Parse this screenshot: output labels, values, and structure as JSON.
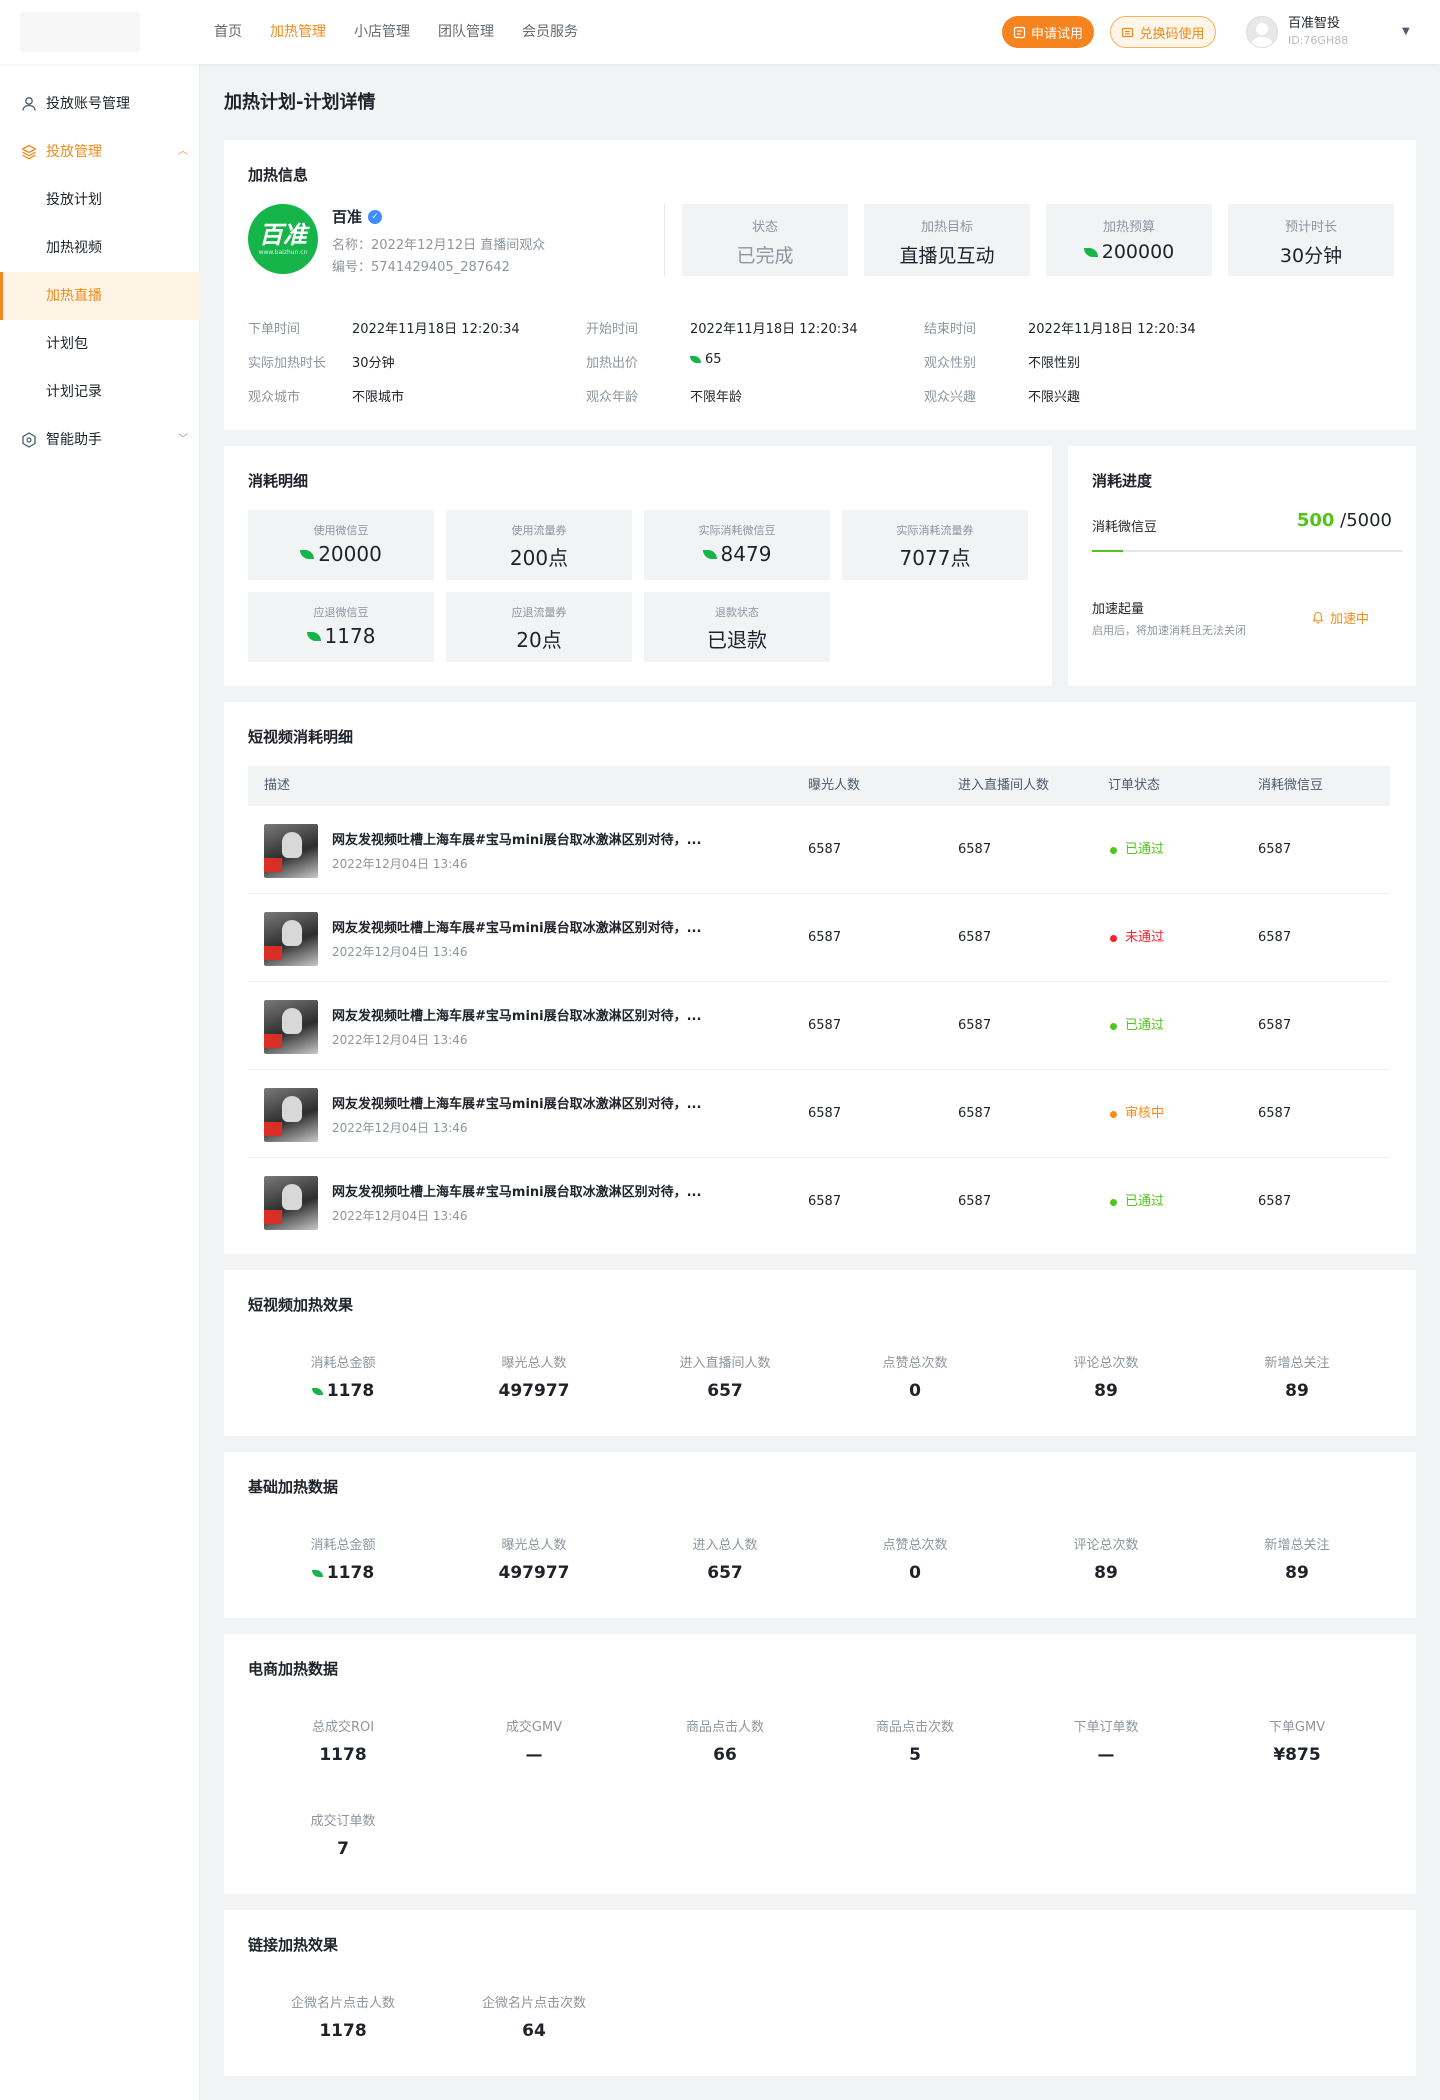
{
  "nav": {
    "items": [
      "首页",
      "加热管理",
      "小店管理",
      "团队管理",
      "会员服务"
    ],
    "active_index": 1,
    "apply_trial": "申请试用",
    "redeem_code": "兑换码使用",
    "user_name": "百准智投",
    "user_id": "ID:76GH88"
  },
  "sidebar": {
    "account_mgmt": "投放账号管理",
    "delivery_mgmt": "投放管理",
    "sub_items": [
      "投放计划",
      "加热视频",
      "加热直播",
      "计划包",
      "计划记录"
    ],
    "active_sub_index": 2,
    "assistant": "智能助手"
  },
  "page_title": "加热计划-计划详情",
  "heat_info": {
    "title": "加热信息",
    "logo_text": "百准",
    "logo_sub": "www.baizhun.cn",
    "account_name": "百准",
    "name_line": "名称：2022年12月12日 直播间观众",
    "id_line": "编号：5741429405_287642",
    "stats": [
      {
        "label": "状态",
        "value": "已完成"
      },
      {
        "label": "加热目标",
        "value": "直播见互动"
      },
      {
        "label": "加热预算",
        "value": "200000"
      },
      {
        "label": "预计时长",
        "value": "30分钟"
      }
    ],
    "fields": [
      {
        "label": "下单时间",
        "value": "2022年11月18日 12:20:34"
      },
      {
        "label": "开始时间",
        "value": "2022年11月18日 12:20:34"
      },
      {
        "label": "结束时间",
        "value": "2022年11月18日 12:20:34"
      },
      {
        "label": "实际加热时长",
        "value": "30分钟"
      },
      {
        "label": "加热出价",
        "value": "65"
      },
      {
        "label": "观众性别",
        "value": "不限性别"
      },
      {
        "label": "观众城市",
        "value": "不限城市"
      },
      {
        "label": "观众年龄",
        "value": "不限年龄"
      },
      {
        "label": "观众兴趣",
        "value": "不限兴趣"
      }
    ]
  },
  "consume_detail": {
    "title": "消耗明细",
    "metrics": [
      {
        "label": "使用微信豆",
        "value": "20000",
        "bean": true
      },
      {
        "label": "使用流量券",
        "value": "200点",
        "bean": false
      },
      {
        "label": "实际消耗微信豆",
        "value": "8479",
        "bean": true
      },
      {
        "label": "实际消耗流量券",
        "value": "7077点",
        "bean": false
      },
      {
        "label": "应退微信豆",
        "value": "1178",
        "bean": true
      },
      {
        "label": "应退流量券",
        "value": "20点",
        "bean": false
      },
      {
        "label": "退款状态",
        "value": "已退款",
        "bean": false
      }
    ]
  },
  "consume_progress": {
    "title": "消耗进度",
    "label": "消耗微信豆",
    "used": "500",
    "total": "/5000",
    "fraction": 0.1,
    "accel_title": "加速起量",
    "accel_desc": "启用后，将加速消耗且无法关闭",
    "accel_status": "加速中"
  },
  "video_table": {
    "title": "短视频消耗明细",
    "headers": [
      "描述",
      "曝光人数",
      "进入直播间人数",
      "订单状态",
      "消耗微信豆"
    ],
    "rows": [
      {
        "title": "网友发视频吐槽上海车展#宝马mini展台取冰激淋区别对待，...",
        "date": "2022年12月04日 13:46",
        "exposure": "6587",
        "enter": "6587",
        "status": "已通过",
        "status_color": "#52c41a",
        "beans": "6587"
      },
      {
        "title": "网友发视频吐槽上海车展#宝马mini展台取冰激淋区别对待，...",
        "date": "2022年12月04日 13:46",
        "exposure": "6587",
        "enter": "6587",
        "status": "未通过",
        "status_color": "#f5222d",
        "beans": "6587"
      },
      {
        "title": "网友发视频吐槽上海车展#宝马mini展台取冰激淋区别对待，...",
        "date": "2022年12月04日 13:46",
        "exposure": "6587",
        "enter": "6587",
        "status": "已通过",
        "status_color": "#52c41a",
        "beans": "6587"
      },
      {
        "title": "网友发视频吐槽上海车展#宝马mini展台取冰激淋区别对待，...",
        "date": "2022年12月04日 13:46",
        "exposure": "6587",
        "enter": "6587",
        "status": "审核中",
        "status_color": "#fa8c16",
        "beans": "6587"
      },
      {
        "title": "网友发视频吐槽上海车展#宝马mini展台取冰激淋区别对待，...",
        "date": "2022年12月04日 13:46",
        "exposure": "6587",
        "enter": "6587",
        "status": "已通过",
        "status_color": "#52c41a",
        "beans": "6587"
      }
    ]
  },
  "video_effect": {
    "title": "短视频加热效果",
    "stats": [
      {
        "label": "消耗总金额",
        "value": "1178",
        "bean": true
      },
      {
        "label": "曝光总人数",
        "value": "497977"
      },
      {
        "label": "进入直播间人数",
        "value": "657"
      },
      {
        "label": "点赞总次数",
        "value": "0"
      },
      {
        "label": "评论总次数",
        "value": "89"
      },
      {
        "label": "新增总关注",
        "value": "89"
      }
    ]
  },
  "basic_data": {
    "title": "基础加热数据",
    "stats": [
      {
        "label": "消耗总金额",
        "value": "1178",
        "bean": true
      },
      {
        "label": "曝光总人数",
        "value": "497977"
      },
      {
        "label": "进入总人数",
        "value": "657"
      },
      {
        "label": "点赞总次数",
        "value": "0"
      },
      {
        "label": "评论总次数",
        "value": "89"
      },
      {
        "label": "新增总关注",
        "value": "89"
      }
    ]
  },
  "ecom_data": {
    "title": "电商加热数据",
    "stats": [
      {
        "label": "总成交ROI",
        "value": "1178"
      },
      {
        "label": "成交GMV",
        "value": "—"
      },
      {
        "label": "商品点击人数",
        "value": "66"
      },
      {
        "label": "商品点击次数",
        "value": "5"
      },
      {
        "label": "下单订单数",
        "value": "—"
      },
      {
        "label": "下单GMV",
        "value": "¥875"
      },
      {
        "label": "成交订单数",
        "value": "7"
      }
    ]
  },
  "link_effect": {
    "title": "链接加热效果",
    "stats": [
      {
        "label": "企微名片点击人数",
        "value": "1178"
      },
      {
        "label": "企微名片点击次数",
        "value": "64"
      }
    ]
  },
  "colors": {
    "accent": "#f08c1e",
    "bean_green": "#16b54a",
    "pass": "#52c41a",
    "fail": "#f5222d",
    "reviewing": "#fa8c16"
  }
}
